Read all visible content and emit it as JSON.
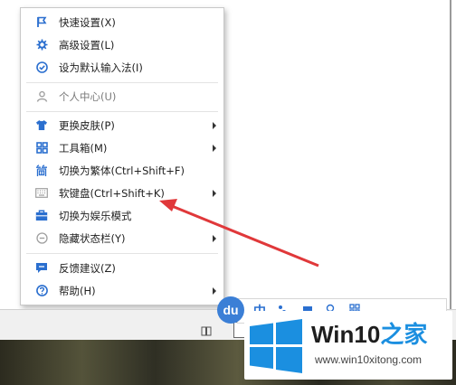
{
  "menu": {
    "items": [
      {
        "label": "快速设置(X)",
        "icon": "flag-icon",
        "submenu": false,
        "disabled": false
      },
      {
        "label": "高级设置(L)",
        "icon": "gear-icon",
        "submenu": false,
        "disabled": false
      },
      {
        "label": "设为默认输入法(I)",
        "icon": "check-circle-icon",
        "submenu": false,
        "disabled": false
      },
      {
        "label": "个人中心(U)",
        "icon": "person-icon",
        "submenu": false,
        "disabled": true
      },
      {
        "label": "更换皮肤(P)",
        "icon": "shirt-icon",
        "submenu": true,
        "disabled": false
      },
      {
        "label": "工具箱(M)",
        "icon": "grid-icon",
        "submenu": true,
        "disabled": false
      },
      {
        "label": "切换为繁体(Ctrl+Shift+F)",
        "icon": "traditional-char-icon",
        "submenu": false,
        "disabled": false
      },
      {
        "label": "软键盘(Ctrl+Shift+K)",
        "icon": "keyboard-icon",
        "submenu": true,
        "disabled": false
      },
      {
        "label": "切换为娱乐模式",
        "icon": "briefcase-icon",
        "submenu": false,
        "disabled": false
      },
      {
        "label": "隐藏状态栏(Y)",
        "icon": "minus-circle-icon",
        "submenu": true,
        "disabled": false
      },
      {
        "label": "反馈建议(Z)",
        "icon": "chat-bubble-icon",
        "submenu": false,
        "disabled": false
      },
      {
        "label": "帮助(H)",
        "icon": "help-circle-icon",
        "submenu": true,
        "disabled": false
      }
    ]
  },
  "ime_bar": {
    "logo_text": "du",
    "mode_label": "中"
  },
  "watermark": {
    "title_prefix": "Win10",
    "title_suffix": "之家",
    "url": "www.win10xitong.com"
  },
  "colors": {
    "icon_blue": "#2b6fcf",
    "disabled_gray": "#9a9a9a",
    "arrow_red": "#e0383a",
    "windows_blue": "#1b8fe0"
  }
}
